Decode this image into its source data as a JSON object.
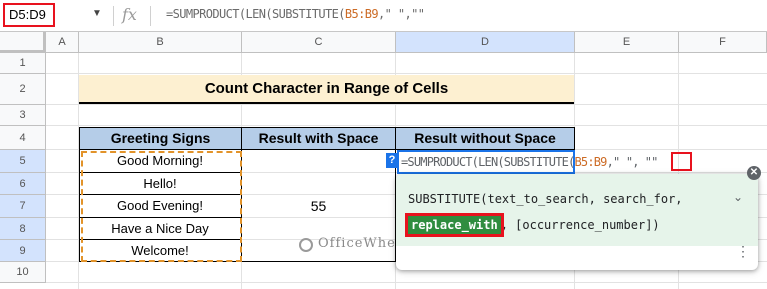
{
  "formula_bar": {
    "name_box": "D5:D9",
    "fx": "fx",
    "formula_prefix": "=SUMPRODUCT(LEN(SUBSTITUTE(",
    "formula_ref": "B5:B9",
    "formula_suffix": ",\" \",\"\""
  },
  "columns": [
    "A",
    "B",
    "C",
    "D",
    "E",
    "F"
  ],
  "rows": [
    "1",
    "2",
    "3",
    "4",
    "5",
    "6",
    "7",
    "8",
    "9",
    "10"
  ],
  "sheet": {
    "title": "Count Character in Range of Cells",
    "headers": [
      "Greeting Signs",
      "Result with Space",
      "Result without Space"
    ],
    "greetings": [
      "Good Morning!",
      "Hello!",
      "Good Evening!",
      "Have a Nice Day",
      "Welcome!"
    ],
    "result_with_space": "55"
  },
  "edit_cell": {
    "prefix": "=SUMPRODUCT(LEN(SUBSTITUTE(",
    "ref": "B5:B9",
    "suffix": ",\" \",",
    "tail": "\"\"",
    "help_button": "?"
  },
  "tooltip": {
    "line1": "SUBSTITUTE(text_to_search, search_for,",
    "current_arg": "replace_with",
    "line2_rest": ", [occurrence_number])",
    "chevron": "⌄",
    "close": "✕",
    "kebab": "⋮"
  },
  "watermark": "OfficeWheel",
  "colors": {
    "header_fill": "#b5cde8",
    "title_fill": "#fdf0d1",
    "selection_dash": "#e2932a",
    "tooltip_fill": "#e6f4ea",
    "highlight_red": "#e8121e",
    "active_blue": "#1a73e8"
  }
}
